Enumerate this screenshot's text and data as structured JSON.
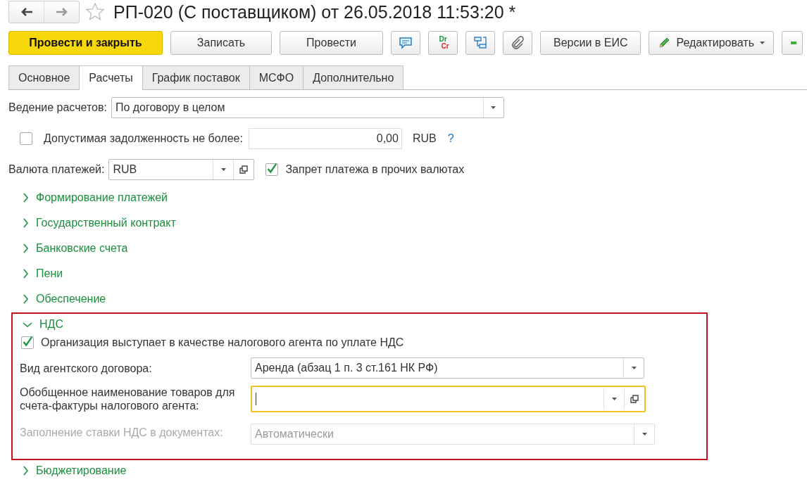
{
  "window": {
    "title": "РП-020 (С поставщиком) от 26.05.2018 11:53:20 *",
    "favorite": false
  },
  "toolbar": [
    {
      "kind": "primary",
      "label": "Провести и закрыть"
    },
    {
      "kind": "text",
      "label": "Записать"
    },
    {
      "kind": "text",
      "label": "Провести"
    },
    {
      "kind": "icon"
    },
    {
      "kind": "icon",
      "label": "Dr",
      "label2": "Cr"
    },
    {
      "kind": "icon"
    },
    {
      "kind": "icon"
    },
    {
      "kind": "text",
      "label": "Версии в ЕИС"
    },
    {
      "kind": "menu",
      "label": "Редактировать"
    },
    {
      "kind": "cut"
    }
  ],
  "tabs": [
    {
      "label": "Основное",
      "selected": false
    },
    {
      "label": "Расчеты",
      "selected": true
    },
    {
      "label": "График поставок",
      "selected": false
    },
    {
      "label": "МСФО",
      "selected": false
    },
    {
      "label": "Дополнительно",
      "selected": false
    }
  ],
  "settlement": {
    "label": "Ведение расчетов:",
    "value": "По договору в целом"
  },
  "debt": {
    "checked": false,
    "label": "Допустимая задолженность не более:",
    "value": "0,00",
    "currency": "RUB",
    "help": "?"
  },
  "currency": {
    "label": "Валюта платежей:",
    "value": "RUB",
    "ban": {
      "checked": true,
      "label": "Запрет платежа в прочих валютах"
    }
  },
  "sections": [
    {
      "label": "Формирование платежей",
      "expanded": false
    },
    {
      "label": "Государственный контракт",
      "expanded": false
    },
    {
      "label": "Банковские счета",
      "expanded": false
    },
    {
      "label": "Пени",
      "expanded": false
    },
    {
      "label": "Обеспечение",
      "expanded": false
    }
  ],
  "vat": {
    "label": "НДС",
    "expanded": true,
    "highlighted": true,
    "agent": {
      "checked": true,
      "label": "Организация выступает в качестве налогового агента по уплате НДС"
    },
    "fields": [
      {
        "label": "Вид агентского договора:",
        "value": "Аренда (абзац 1 п. 3 ст.161 НК РФ)",
        "focused": false,
        "disabled": false,
        "open": false
      },
      {
        "label": "Обобщенное наименование товаров для счета-фактуры налогового агента:",
        "focused": true,
        "disabled": false,
        "open": true
      },
      {
        "label": "Заполнение ставки НДС в документах:",
        "value": "Автоматически",
        "focused": false,
        "disabled": true,
        "open": false
      }
    ]
  },
  "budget": {
    "label": "Бюджетирование",
    "expanded": false
  }
}
